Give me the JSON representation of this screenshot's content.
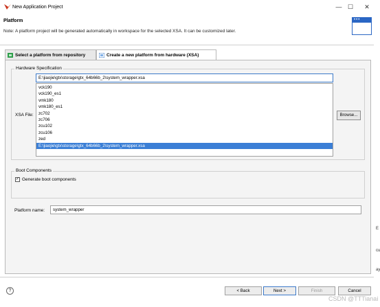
{
  "window": {
    "title": "New Application Project",
    "controls": {
      "minimize": "—",
      "maximize": "☐",
      "close": "✕"
    }
  },
  "header": {
    "title": "Platform",
    "description": "Note: A platform project will be generated automatically in workspace for the selected XSA. It can be customized later.",
    "banner_dots": "•••"
  },
  "tabs": [
    {
      "label": "Select a platform from repository",
      "icon": "green-platform-icon",
      "active": false
    },
    {
      "label": "Create a new platform from hardware (XSA)",
      "icon": "hardware-xsa-icon",
      "active": true
    }
  ],
  "hardware_spec": {
    "legend": "Hardware Specification",
    "xsa_label": "XSA File:",
    "xsa_value": "E:\\jiaojie\\gtx\\storage\\gtx_64b66b_2\\system_wrapper.xsa",
    "options": [
      "vck190",
      "vck190_es1",
      "vmk180",
      "vmk180_es1",
      "zc702",
      "zc706",
      "zcu102",
      "zcu106",
      "zed",
      "E:\\jiaojie\\gtx\\storage\\gtx_64b66b_2\\system_wrapper.xsa"
    ],
    "selected_index": 9,
    "browse_label": "Browse..."
  },
  "boot_components": {
    "legend": "Boot Components",
    "checkbox_label": "Generate boot components",
    "checked": true,
    "check_mark": "✓"
  },
  "platform_name": {
    "label": "Platform name:",
    "value": "system_wrapper"
  },
  "footer": {
    "help_glyph": "?",
    "back_label": "< Back",
    "next_label": "Next >",
    "finish_label": "Finish",
    "cancel_label": "Cancel",
    "finish_enabled": false
  },
  "watermark": "CSDN @TTTianai",
  "edge_text": [
    "E",
    "cu",
    "ay"
  ],
  "colors": {
    "accent": "#3b7fd6",
    "selection": "#3b7fd6",
    "tab_body": "#f4f4f4"
  }
}
